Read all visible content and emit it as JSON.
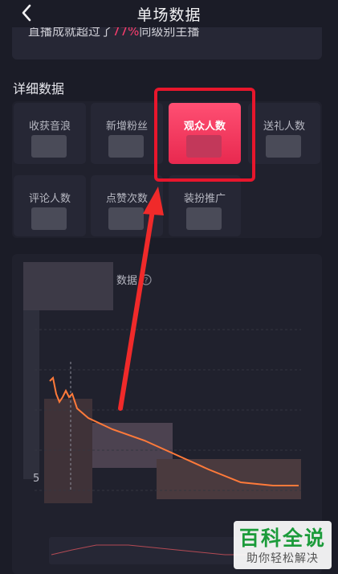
{
  "header": {
    "title": "单场数据"
  },
  "banner": {
    "prefix": "直播成就超过了",
    "percent": "77%",
    "suffix": "同级别主播"
  },
  "section": {
    "title": "详细数据"
  },
  "metrics": [
    {
      "label": "收获音浪"
    },
    {
      "label": "新增粉丝"
    },
    {
      "label": "观众人数",
      "active": true
    },
    {
      "label": "送礼人数"
    },
    {
      "label": "评论人数"
    },
    {
      "label": "点赞次数"
    },
    {
      "label": "装扮推广"
    }
  ],
  "chart": {
    "title": "数据",
    "axis_value": "5"
  },
  "watermark": {
    "main": "百科全说",
    "sub": "助你轻松解决"
  },
  "colors": {
    "accent": "#ff3d6e",
    "highlight": "#e8162c",
    "background": "#1b1c27"
  },
  "icons": {
    "back": "chevron-left-icon",
    "help": "question-circle-icon"
  }
}
